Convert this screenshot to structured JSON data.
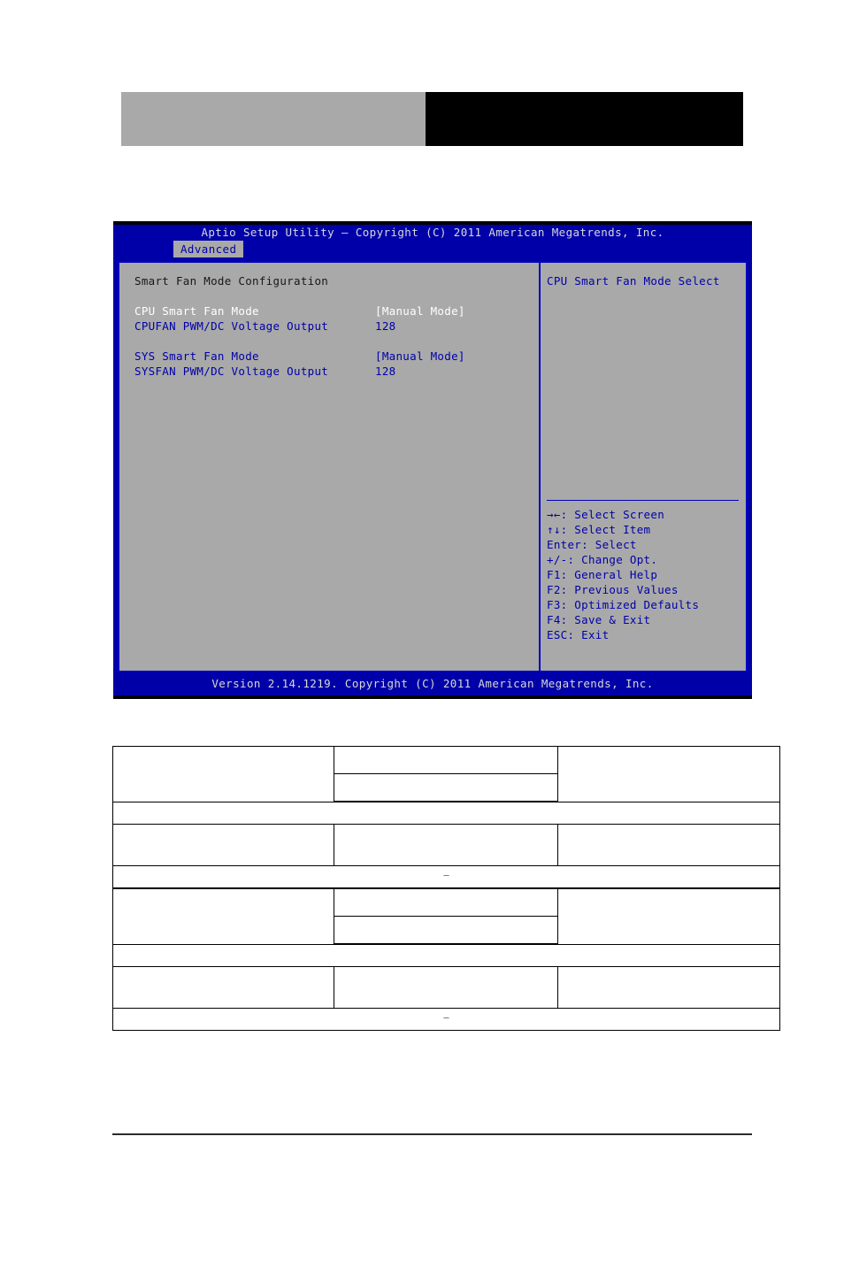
{
  "header": {
    "left_block_color": "#a9a9a9",
    "right_block_color": "#000000"
  },
  "bios": {
    "title": "Aptio Setup Utility – Copyright (C) 2011 American Megatrends, Inc.",
    "tab": "Advanced",
    "footer": "Version 2.14.1219. Copyright (C) 2011 American Megatrends, Inc.",
    "accent_blue": "#0000a8",
    "panel_gray": "#a9a9a9",
    "section_heading": "Smart Fan Mode Configuration",
    "items": [
      {
        "label": "CPU Smart Fan Mode",
        "value": "[Manual Mode]",
        "selected": true
      },
      {
        "label": "CPUFAN PWM/DC Voltage Output",
        "value": "128",
        "selected": false
      },
      {
        "label": "SYS Smart Fan Mode",
        "value": "[Manual Mode]",
        "selected": false
      },
      {
        "label": "SYSFAN PWM/DC Voltage Output",
        "value": "128",
        "selected": false
      }
    ],
    "help_title": "CPU Smart Fan Mode Select",
    "help_keys": [
      "→←: Select Screen",
      "↑↓: Select Item",
      "Enter: Select",
      "+/-: Change Opt.",
      "F1: General Help",
      "F2: Previous Values",
      "F3: Optimized Defaults",
      "F4: Save & Exit",
      "ESC: Exit"
    ]
  },
  "option_table": {
    "groups": [
      {
        "name_cell": "",
        "options": [
          "",
          ""
        ],
        "description_cell": "",
        "note_row": ""
      },
      {
        "name_cell": "",
        "options": [
          ""
        ],
        "description_cell": "",
        "note_row": "–"
      },
      {
        "name_cell": "",
        "options": [
          "",
          ""
        ],
        "description_cell": "",
        "note_row": ""
      },
      {
        "name_cell": "",
        "options": [
          ""
        ],
        "description_cell": "",
        "note_row": "–"
      }
    ]
  }
}
